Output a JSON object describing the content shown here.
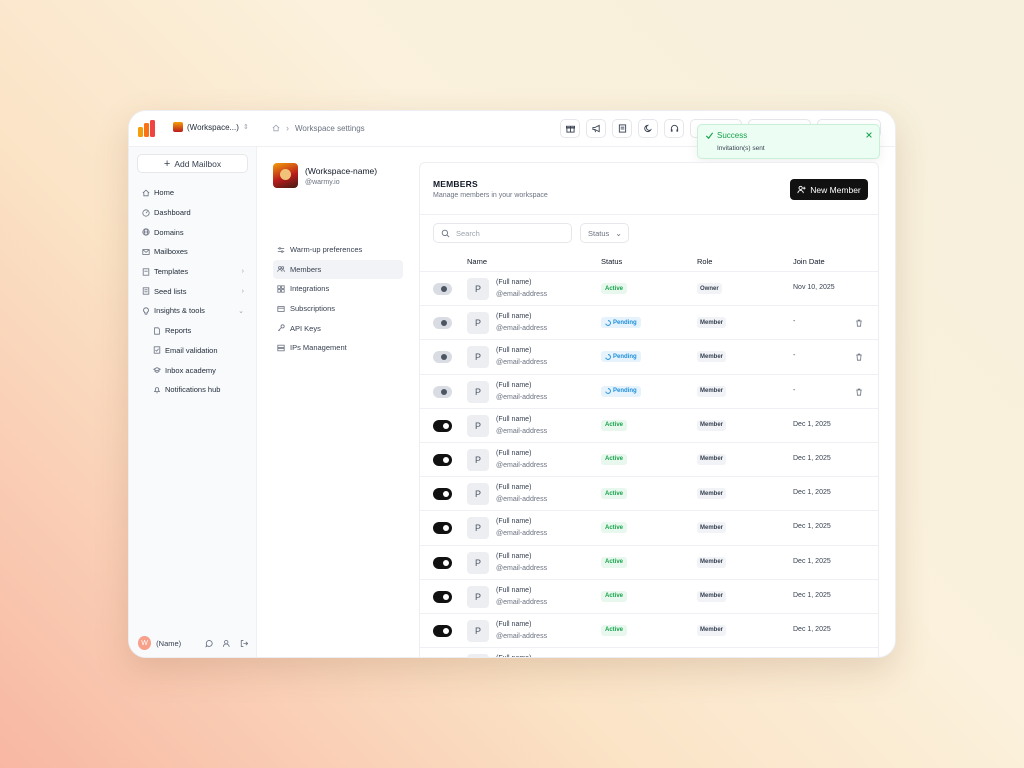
{
  "topbar": {
    "workspace_switch": "(Workspace...)",
    "breadcrumb": "Workspace settings"
  },
  "toast": {
    "title": "Success",
    "message": "Invitation(s) sent"
  },
  "sidebar": {
    "add_mailbox": "Add Mailbox",
    "items": [
      {
        "label": "Home",
        "icon": "home-icon"
      },
      {
        "label": "Dashboard",
        "icon": "dashboard-icon"
      },
      {
        "label": "Domains",
        "icon": "globe-icon"
      },
      {
        "label": "Mailboxes",
        "icon": "mail-icon"
      },
      {
        "label": "Templates",
        "icon": "template-icon",
        "expandable": true
      },
      {
        "label": "Seed lists",
        "icon": "list-icon",
        "expandable": true
      },
      {
        "label": "Insights & tools",
        "icon": "lightbulb-icon",
        "expanded": true
      },
      {
        "label": "Reports",
        "icon": "report-icon",
        "sub": true
      },
      {
        "label": "Email validation",
        "icon": "validation-icon",
        "sub": true
      },
      {
        "label": "Inbox  academy",
        "icon": "graduation-icon",
        "sub": true
      },
      {
        "label": "Notifications hub",
        "icon": "bell-icon",
        "sub": true
      }
    ],
    "user": {
      "initial": "W",
      "name": "(Name)"
    }
  },
  "settings": {
    "workspace_name": "(Workspace-name)",
    "workspace_handle": "@warmy.io",
    "nav": [
      {
        "label": "Warm-up preferences",
        "icon": "sliders-icon"
      },
      {
        "label": "Members",
        "icon": "users-icon",
        "active": true
      },
      {
        "label": "Integrations",
        "icon": "grid-icon"
      },
      {
        "label": "Subscriptions",
        "icon": "card-icon"
      },
      {
        "label": "API Keys",
        "icon": "key-icon"
      },
      {
        "label": "IPs Management",
        "icon": "server-icon"
      }
    ]
  },
  "members": {
    "title": "MEMBERS",
    "subtitle": "Manage members in your workspace",
    "new_member": "New Member",
    "search_placeholder": "Search",
    "status_filter": "Status",
    "columns": [
      "Name",
      "Status",
      "Role",
      "Join Date"
    ],
    "rows": [
      {
        "toggle": "off",
        "initial": "P",
        "name": "(Full name)",
        "email": "@email-address",
        "status": "Active",
        "role": "Owner",
        "joined": "Nov 10, 2025",
        "deletable": false
      },
      {
        "toggle": "off",
        "initial": "P",
        "name": "(Full name)",
        "email": "@email-address",
        "status": "Pending",
        "role": "Member",
        "joined": "-",
        "deletable": true
      },
      {
        "toggle": "off",
        "initial": "P",
        "name": "(Full name)",
        "email": "@email-address",
        "status": "Pending",
        "role": "Member",
        "joined": "-",
        "deletable": true
      },
      {
        "toggle": "off",
        "initial": "P",
        "name": "(Full name)",
        "email": "@email-address",
        "status": "Pending",
        "role": "Member",
        "joined": "-",
        "deletable": true
      },
      {
        "toggle": "on",
        "initial": "P",
        "name": "(Full name)",
        "email": "@email-address",
        "status": "Active",
        "role": "Member",
        "joined": "Dec 1, 2025",
        "deletable": false
      },
      {
        "toggle": "on",
        "initial": "P",
        "name": "(Full name)",
        "email": "@email-address",
        "status": "Active",
        "role": "Member",
        "joined": "Dec 1, 2025",
        "deletable": false
      },
      {
        "toggle": "on",
        "initial": "P",
        "name": "(Full name)",
        "email": "@email-address",
        "status": "Active",
        "role": "Member",
        "joined": "Dec 1, 2025",
        "deletable": false
      },
      {
        "toggle": "on",
        "initial": "P",
        "name": "(Full name)",
        "email": "@email-address",
        "status": "Active",
        "role": "Member",
        "joined": "Dec 1, 2025",
        "deletable": false
      },
      {
        "toggle": "on",
        "initial": "P",
        "name": "(Full name)",
        "email": "@email-address",
        "status": "Active",
        "role": "Member",
        "joined": "Dec 1, 2025",
        "deletable": false
      },
      {
        "toggle": "on",
        "initial": "P",
        "name": "(Full name)",
        "email": "@email-address",
        "status": "Active",
        "role": "Member",
        "joined": "Dec 1, 2025",
        "deletable": false
      },
      {
        "toggle": "on",
        "initial": "P",
        "name": "(Full name)",
        "email": "@email-address",
        "status": "Active",
        "role": "Member",
        "joined": "Dec 1, 2025",
        "deletable": false
      }
    ],
    "partial_row_name": "(Full name)"
  },
  "colors": {
    "accent_dark": "#111111",
    "success": "#16a34a",
    "pending": "#1d8fdc",
    "logo_orange": "#f97316",
    "logo_red": "#ef4444"
  }
}
